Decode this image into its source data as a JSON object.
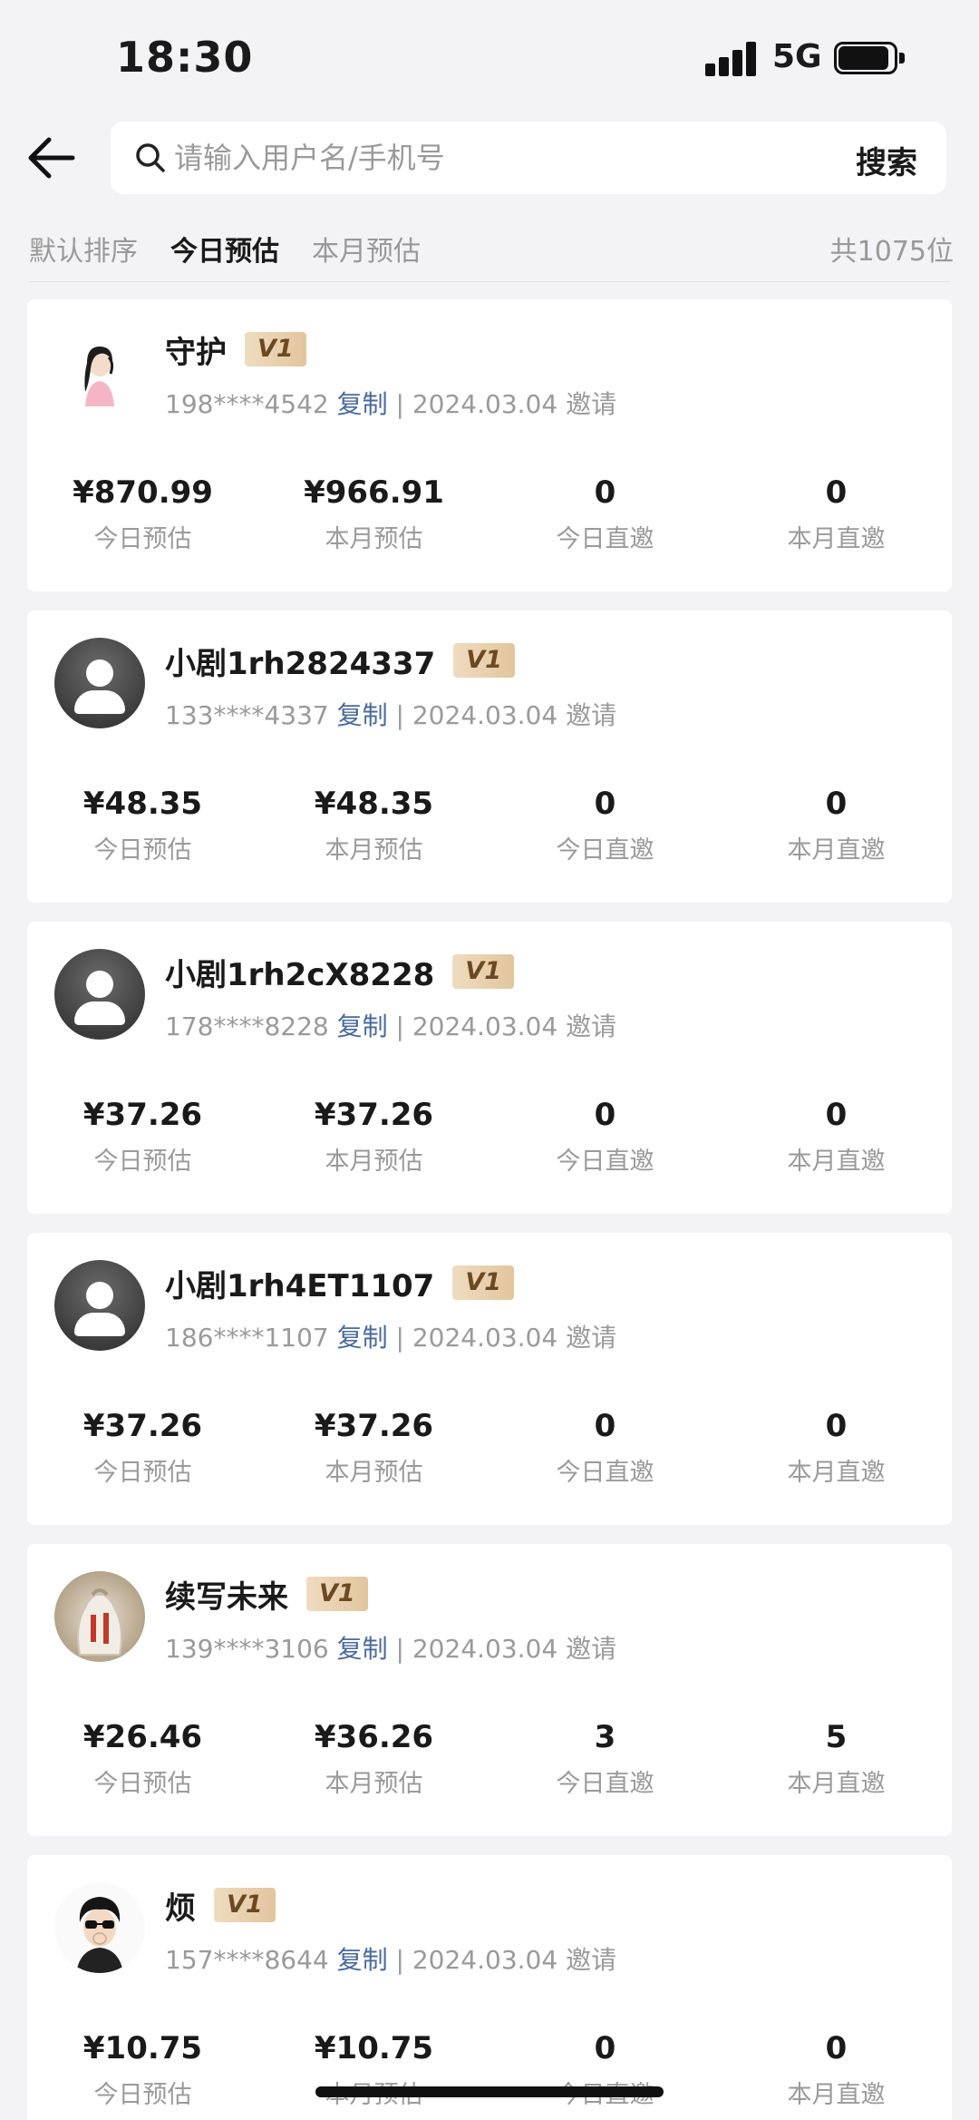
{
  "status_bar": {
    "time": "18:30",
    "network": "5G"
  },
  "search": {
    "placeholder": "请输入用户名/手机号",
    "button_label": "搜索"
  },
  "tabs": [
    {
      "label": "默认排序"
    },
    {
      "label": "今日预估",
      "active": true
    },
    {
      "label": "本月预估"
    }
  ],
  "total_label": "共1075位",
  "stat_labels": [
    "今日预估",
    "本月预估",
    "今日直邀",
    "本月直邀"
  ],
  "members": [
    {
      "name": "守护",
      "level": "V1",
      "phone": "198****4542",
      "copy_label": "复制",
      "invite_text": "| 2024.03.04 邀请",
      "avatar": "photo-girl",
      "today_est": "¥870.99",
      "month_est": "¥966.91",
      "today_invites": "0",
      "month_invites": "0"
    },
    {
      "name": "小剧1rh2824337",
      "level": "V1",
      "phone": "133****4337",
      "copy_label": "复制",
      "invite_text": "| 2024.03.04 邀请",
      "avatar": "default",
      "today_est": "¥48.35",
      "month_est": "¥48.35",
      "today_invites": "0",
      "month_invites": "0"
    },
    {
      "name": "小剧1rh2cX8228",
      "level": "V1",
      "phone": "178****8228",
      "copy_label": "复制",
      "invite_text": "| 2024.03.04 邀请",
      "avatar": "default",
      "today_est": "¥37.26",
      "month_est": "¥37.26",
      "today_invites": "0",
      "month_invites": "0"
    },
    {
      "name": "小剧1rh4ET1107",
      "level": "V1",
      "phone": "186****1107",
      "copy_label": "复制",
      "invite_text": "| 2024.03.04 邀请",
      "avatar": "default",
      "today_est": "¥37.26",
      "month_est": "¥37.26",
      "today_invites": "0",
      "month_invites": "0"
    },
    {
      "name": "续写未来",
      "level": "V1",
      "phone": "139****3106",
      "copy_label": "复制",
      "invite_text": "| 2024.03.04 邀请",
      "avatar": "photo-bag",
      "today_est": "¥26.46",
      "month_est": "¥36.26",
      "today_invites": "3",
      "month_invites": "5"
    },
    {
      "name": "烦",
      "level": "V1",
      "phone": "157****8644",
      "copy_label": "复制",
      "invite_text": "| 2024.03.04 邀请",
      "avatar": "photo-boy",
      "today_est": "¥10.75",
      "month_est": "¥10.75",
      "today_invites": "0",
      "month_invites": "0"
    }
  ],
  "colors": {
    "background": "#f3f3f5",
    "card": "#ffffff",
    "link": "#4a6a9c",
    "badge": "#e2c59e",
    "muted": "#9a9a9a"
  },
  "icons": {
    "back": "arrow-left-icon",
    "search": "search-icon"
  }
}
